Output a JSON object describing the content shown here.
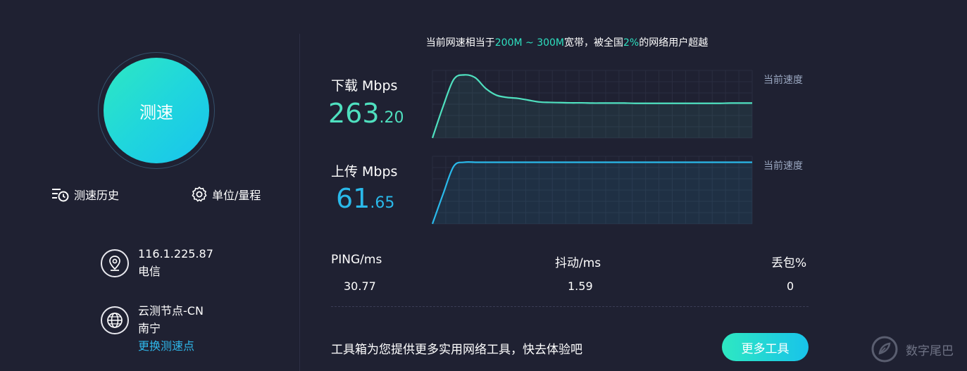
{
  "start_button": {
    "label": "测速"
  },
  "history_link": {
    "label": "测速历史",
    "icon": "history-list-icon"
  },
  "settings_link": {
    "label": "单位/量程",
    "icon": "gear-icon"
  },
  "network": {
    "ip": "116.1.225.87",
    "isp": "电信",
    "icon": "location-pin-icon"
  },
  "node": {
    "name": "云测节点-CN",
    "city": "南宁",
    "change_label": "更换测速点",
    "icon": "globe-icon"
  },
  "summary": {
    "prefix": "当前网速相当于",
    "range": "200M ~ 300M",
    "middle": "宽带，被全国",
    "percent": "2%",
    "suffix": "的网络用户超越"
  },
  "download": {
    "label": "下载 Mbps",
    "int": "263",
    "dec": ".20",
    "current_label": "当前速度",
    "color": "#4fe0bf"
  },
  "upload": {
    "label": "上传 Mbps",
    "int": "61",
    "dec": ".65",
    "current_label": "当前速度",
    "color": "#2ab9ea"
  },
  "chart_data": [
    {
      "type": "line",
      "name": "download",
      "x": [
        0,
        1,
        2,
        3,
        4,
        5,
        6,
        7,
        8,
        9,
        10,
        11,
        12,
        13,
        14,
        15,
        16,
        17,
        18,
        19,
        20,
        21,
        22,
        23,
        24,
        25,
        26,
        27,
        28,
        29,
        30
      ],
      "y": [
        0,
        140,
        260,
        280,
        268,
        220,
        190,
        180,
        176,
        168,
        160,
        158,
        157,
        156,
        156,
        155,
        155,
        155,
        155,
        154,
        154,
        154,
        154,
        154,
        154,
        154,
        154,
        154,
        155,
        155,
        155
      ],
      "ylim": [
        0,
        300
      ]
    },
    {
      "type": "line",
      "name": "upload",
      "x": [
        0,
        1,
        2,
        3,
        4,
        5,
        6,
        7,
        8,
        9,
        10,
        11,
        12,
        13,
        14,
        15,
        16,
        17,
        18,
        19,
        20,
        21,
        22,
        23,
        24,
        25,
        26,
        27,
        28,
        29,
        30
      ],
      "y": [
        0,
        30,
        58,
        62,
        62,
        62,
        62,
        62,
        62,
        62,
        62,
        62,
        62,
        62,
        62,
        62,
        62,
        62,
        62,
        62,
        62,
        62,
        62,
        62,
        62,
        62,
        62,
        62,
        62,
        62,
        62
      ],
      "ylim": [
        0,
        68
      ]
    }
  ],
  "stats": {
    "ping": {
      "label": "PING/ms",
      "value": "30.77"
    },
    "jitter": {
      "label": "抖动/ms",
      "value": "1.59"
    },
    "loss": {
      "label": "丢包%",
      "value": "0"
    }
  },
  "tools": {
    "text": "工具箱为您提供更多实用网络工具，快去体验吧",
    "button": "更多工具"
  },
  "watermark": {
    "text": "数字尾巴"
  }
}
